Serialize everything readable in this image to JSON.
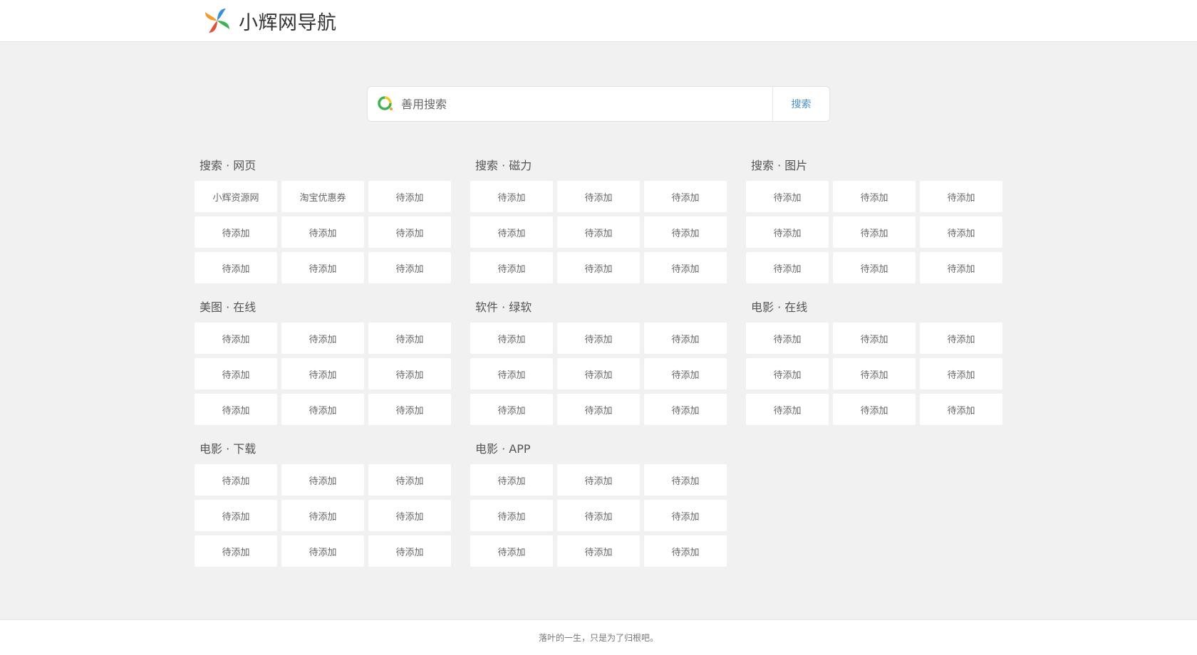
{
  "header": {
    "site_name": "小辉网导航",
    "logo_icon": "pinwheel-logo-icon"
  },
  "search": {
    "engine_icon": "engine-ring-icon",
    "placeholder": "善用搜索",
    "value": "",
    "button_label": "搜索"
  },
  "sections": [
    {
      "title": "搜索 · 网页",
      "links": [
        "小辉资源网",
        "淘宝优惠券",
        "待添加",
        "待添加",
        "待添加",
        "待添加",
        "待添加",
        "待添加",
        "待添加"
      ]
    },
    {
      "title": "搜索 · 磁力",
      "links": [
        "待添加",
        "待添加",
        "待添加",
        "待添加",
        "待添加",
        "待添加",
        "待添加",
        "待添加",
        "待添加"
      ]
    },
    {
      "title": "搜索 · 图片",
      "links": [
        "待添加",
        "待添加",
        "待添加",
        "待添加",
        "待添加",
        "待添加",
        "待添加",
        "待添加",
        "待添加"
      ]
    },
    {
      "title": "美图 · 在线",
      "links": [
        "待添加",
        "待添加",
        "待添加",
        "待添加",
        "待添加",
        "待添加",
        "待添加",
        "待添加",
        "待添加"
      ]
    },
    {
      "title": "软件 · 绿软",
      "links": [
        "待添加",
        "待添加",
        "待添加",
        "待添加",
        "待添加",
        "待添加",
        "待添加",
        "待添加",
        "待添加"
      ]
    },
    {
      "title": "电影 · 在线",
      "links": [
        "待添加",
        "待添加",
        "待添加",
        "待添加",
        "待添加",
        "待添加",
        "待添加",
        "待添加",
        "待添加"
      ]
    },
    {
      "title": "电影 · 下载",
      "links": [
        "待添加",
        "待添加",
        "待添加",
        "待添加",
        "待添加",
        "待添加",
        "待添加",
        "待添加",
        "待添加"
      ]
    },
    {
      "title": "电影 · APP",
      "links": [
        "待添加",
        "待添加",
        "待添加",
        "待添加",
        "待添加",
        "待添加",
        "待添加",
        "待添加",
        "待添加"
      ]
    }
  ],
  "footer": {
    "text": "落叶的一生，只是为了归根吧。"
  },
  "colors": {
    "background": "#f1f1f1",
    "card": "#ffffff",
    "search_button_text": "#4a90c6",
    "logo_blue": "#3b8fd8",
    "logo_green": "#3fb34f",
    "logo_orange": "#f39c2b",
    "logo_red": "#e2533a"
  }
}
